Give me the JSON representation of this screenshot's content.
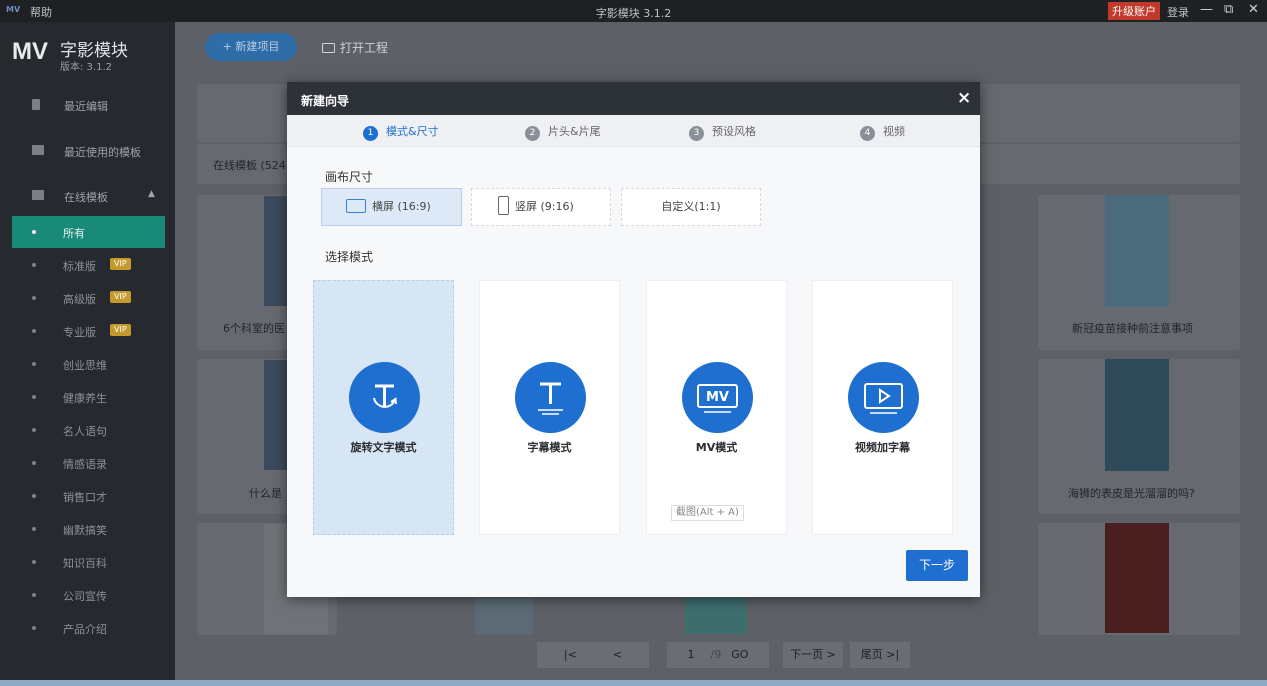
{
  "titlebar": {
    "logo": "MV",
    "help": "帮助",
    "title": "字影模块 3.1.2",
    "upgrade": "升级账户",
    "login": "登录",
    "minimize": "—",
    "restore": "⧉",
    "close": "✕"
  },
  "brand": {
    "logo": "MV",
    "name": "字影模块",
    "version": "版本: 3.1.2"
  },
  "sidebar": {
    "recent_edit": "最近编辑",
    "recent_templates": "最近使用的模板",
    "online_templates": "在线模板",
    "caret": "▲",
    "vip_badge": "VIP",
    "categories": [
      "所有",
      "标准版",
      "高级版",
      "专业版",
      "创业思维",
      "健康养生",
      "名人语句",
      "情感语录",
      "销售口才",
      "幽默搞笑",
      "知识百科",
      "公司宣传",
      "产品介绍"
    ]
  },
  "main": {
    "new_project": "+ 新建项目",
    "open_project": "打开工程",
    "online_count": "在线模板 (524",
    "bg_texts": {
      "t1": "6个科室的医",
      "t2": "新冠疫苗接种前注意事项",
      "t3": "什么是",
      "t4": "海狮的表皮是光溜溜的吗?"
    },
    "pager": {
      "first": "|<",
      "prev": "<",
      "page": "1",
      "total": "/9",
      "go": "GO",
      "next": "下一页 >",
      "last": "尾页 >|"
    }
  },
  "dialog": {
    "title": "新建向导",
    "close": "×",
    "steps": [
      {
        "num": "1",
        "label": "模式&尺寸"
      },
      {
        "num": "2",
        "label": "片头&片尾"
      },
      {
        "num": "3",
        "label": "预设风格"
      },
      {
        "num": "4",
        "label": "视频"
      }
    ],
    "canvas_label": "画布尺寸",
    "sizes": {
      "landscape": "横屏 (16:9)",
      "portrait": "竖屏 (9:16)",
      "custom": "自定义(1:1)"
    },
    "mode_label": "选择模式",
    "modes": {
      "rotate": "旋转文字模式",
      "subtitle": "字幕模式",
      "mv": "MV模式",
      "video": "视频加字幕"
    },
    "mv_icon_text": "MV",
    "tooltip": "截图(Alt + A)",
    "next": "下一步"
  }
}
